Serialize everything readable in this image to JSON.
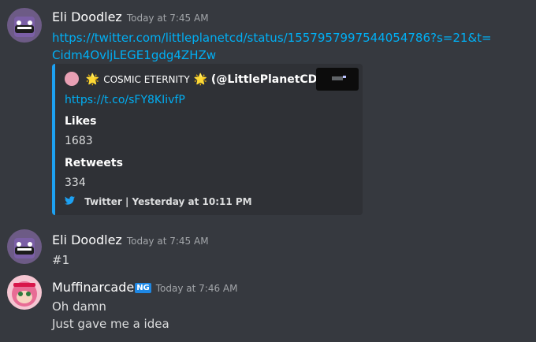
{
  "messages": [
    {
      "username": "Eli Doodlez",
      "timestamp": "Today at 7:45 AM",
      "link_line1": "https://twitter.com/littleplanetcd/status/1557957997544054786?s=21&t=",
      "link_line2": "Cidm4OvljLEGE1gdg4ZHZw"
    },
    {
      "username": "Eli Doodlez",
      "timestamp": "Today at 7:45 AM",
      "text": "#1"
    },
    {
      "username": "Muffinarcade",
      "badge": "NG",
      "timestamp": "Today at 7:46 AM",
      "text_line1": "Oh damn",
      "text_line2": "Just gave me a idea"
    }
  ],
  "embed": {
    "author_prefix": "🌟",
    "author_name": "COSMIC ETERNITY",
    "author_suffix": "🌟",
    "author_handle": "(@LittlePlanetCD)",
    "short_link": "https://t.co/sFY8KIivfP",
    "fields": [
      {
        "name": "Likes",
        "value": "1683"
      },
      {
        "name": "Retweets",
        "value": "334"
      }
    ],
    "footer": "Twitter | Yesterday at 10:11 PM",
    "accent": "#1da1f2"
  }
}
